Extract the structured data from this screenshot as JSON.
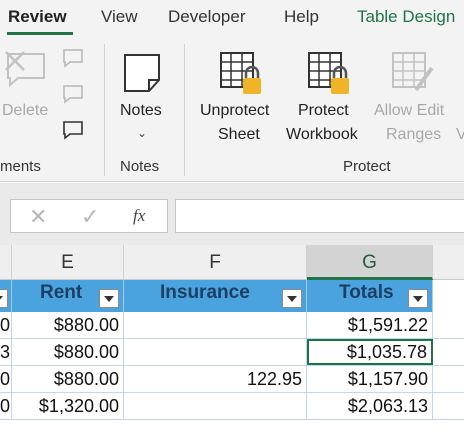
{
  "tabs": [
    {
      "label": "Review",
      "active": true
    },
    {
      "label": "View"
    },
    {
      "label": "Developer"
    },
    {
      "label": "Help"
    },
    {
      "label": "Table Design"
    }
  ],
  "ribbon": {
    "comments_group": {
      "delete_label": "Delete",
      "group_label_partial": "ments"
    },
    "notes_group": {
      "notes_button": "Notes",
      "group_label": "Notes"
    },
    "protect_group": {
      "unprotect_sheet": [
        "Unprotect",
        "Sheet"
      ],
      "protect_workbook": [
        "Protect",
        "Workbook"
      ],
      "allow_edit_ranges": [
        "Allow Edit",
        "Ranges"
      ],
      "overflow_partial": "V",
      "group_label": "Protect"
    }
  },
  "formula_bar": {
    "cancel": "✕",
    "enter": "✓",
    "fx": "fx",
    "value": ""
  },
  "columns": [
    "E",
    "F",
    "G"
  ],
  "selected_column": "G",
  "table": {
    "headers": {
      "rent": "Rent",
      "insurance": "Insurance",
      "totals": "Totals"
    },
    "rows": [
      {
        "prev": "0",
        "rent": "$880.00",
        "insurance": "",
        "totals": "$1,591.22"
      },
      {
        "prev": "3",
        "rent": "$880.00",
        "insurance": "",
        "totals": "$1,035.78"
      },
      {
        "prev": "0",
        "rent": "$880.00",
        "insurance": "122.95",
        "totals": "$1,157.90"
      },
      {
        "prev": "0",
        "rent": "$1,320.00",
        "insurance": "",
        "totals": "$2,063.13"
      }
    ]
  },
  "colors": {
    "accent": "#217346",
    "table_header": "#4aa3df",
    "lock": "#f0b429"
  }
}
